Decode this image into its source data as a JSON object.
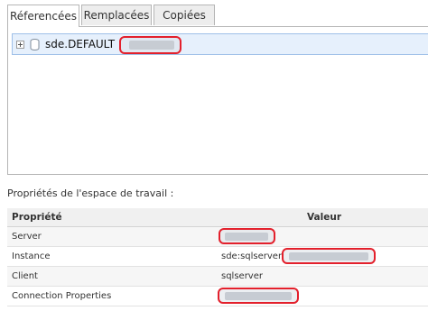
{
  "tabs": [
    {
      "label": "Réferencées",
      "active": true
    },
    {
      "label": "Remplacées",
      "active": false
    },
    {
      "label": "Copiées",
      "active": false
    }
  ],
  "tree": {
    "items": [
      {
        "label": "sde.DEFAULT",
        "icon": "database-icon",
        "expand_icon": "expand-plus-icon"
      }
    ]
  },
  "properties": {
    "title": "Propriétés de l'espace de travail :",
    "columns": {
      "name": "Propriété",
      "value": "Valeur"
    },
    "rows": [
      {
        "name": "Server",
        "value": ""
      },
      {
        "name": "Instance",
        "value": "sde:sqlserver:"
      },
      {
        "name": "Client",
        "value": "sqlserver"
      },
      {
        "name": "Connection Properties",
        "value": ""
      }
    ]
  },
  "colors": {
    "selection_bg": "#e6f0fc",
    "selection_border": "#9fc0e8",
    "highlight_outline": "#e3202c"
  }
}
